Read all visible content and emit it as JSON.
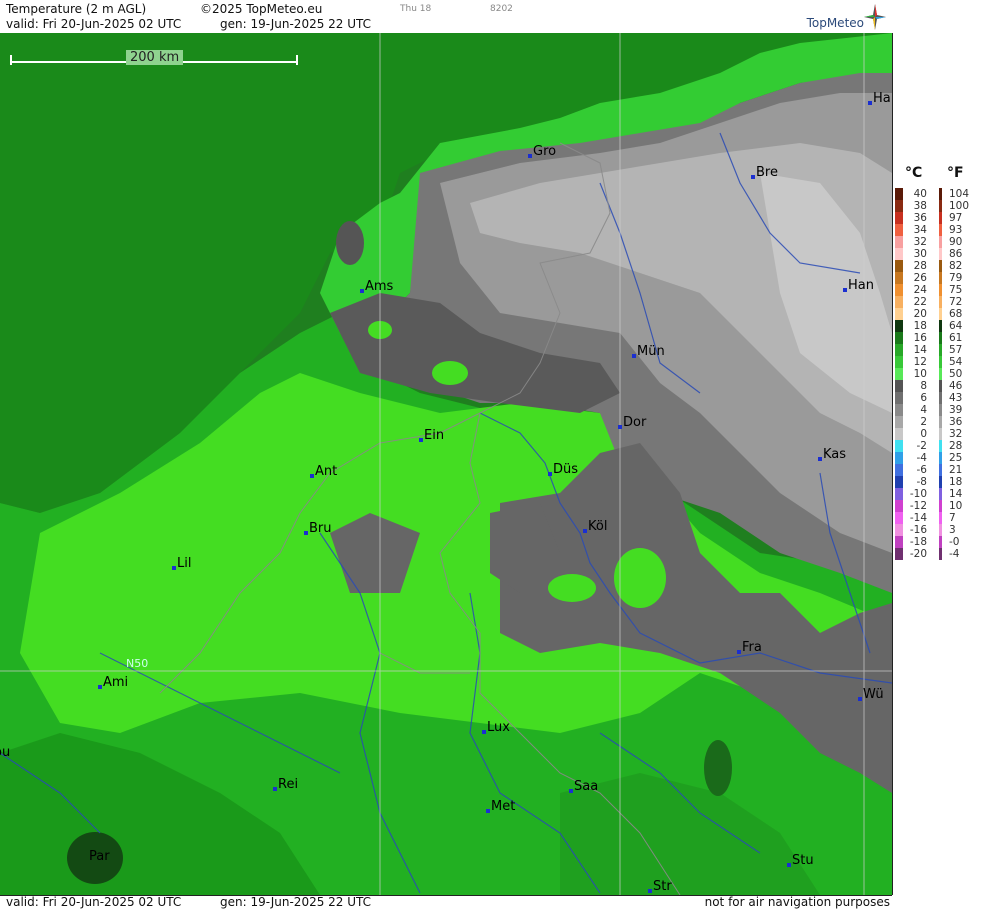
{
  "header": {
    "title": "Temperature (2 m AGL)",
    "copyright": "©2025 TopMeteo.eu",
    "valid": "valid:  Fri  20-Jun-2025  02 UTC",
    "gen": "gen: 19-Jun-2025 22 UTC",
    "small_day": "Thu 18",
    "small_code": "8202",
    "brand": "TopMeteo"
  },
  "footer": {
    "valid": "valid:  Fri  20-Jun-2025  02 UTC",
    "gen": "gen: 19-Jun-2025 22 UTC",
    "disclaimer": "not for air navigation purposes"
  },
  "map": {
    "scale_label": "200 km",
    "gridline_label": "N50",
    "cities": [
      {
        "name": "Gro"
      },
      {
        "name": "Bre"
      },
      {
        "name": "Ha"
      },
      {
        "name": "Ams"
      },
      {
        "name": "Han"
      },
      {
        "name": "Mün"
      },
      {
        "name": "Ein"
      },
      {
        "name": "Dor"
      },
      {
        "name": "Ant"
      },
      {
        "name": "Düs"
      },
      {
        "name": "Kas"
      },
      {
        "name": "Bru"
      },
      {
        "name": "Köl"
      },
      {
        "name": "Lil"
      },
      {
        "name": "Fra"
      },
      {
        "name": "Ami"
      },
      {
        "name": "Wü"
      },
      {
        "name": "ou"
      },
      {
        "name": "Lux"
      },
      {
        "name": "Rei"
      },
      {
        "name": "Saa"
      },
      {
        "name": "Met"
      },
      {
        "name": "Par"
      },
      {
        "name": "Stu"
      },
      {
        "name": "Str"
      }
    ]
  },
  "legend": {
    "celsius_label": "°C",
    "fahrenheit_label": "°F",
    "celsius": [
      "40",
      "38",
      "36",
      "34",
      "32",
      "30",
      "28",
      "26",
      "24",
      "22",
      "20",
      "18",
      "16",
      "14",
      "12",
      "10",
      "8",
      "6",
      "4",
      "2",
      "0",
      "-2",
      "-4",
      "-6",
      "-8",
      "-10",
      "-12",
      "-14",
      "-16",
      "-18",
      "-20"
    ],
    "fahrenheit": [
      "104",
      "100",
      "97",
      "93",
      "90",
      "86",
      "82",
      "79",
      "75",
      "72",
      "68",
      "64",
      "61",
      "57",
      "54",
      "50",
      "46",
      "43",
      "39",
      "36",
      "32",
      "28",
      "25",
      "21",
      "18",
      "14",
      "10",
      "7",
      "3",
      "-0",
      "-4"
    ],
    "colors": [
      "#5a1a08",
      "#8a2a12",
      "#c83020",
      "#f06040",
      "#f8a0a0",
      "#ffc8c8",
      "#9a5a10",
      "#c87820",
      "#f09030",
      "#f8b060",
      "#ffd090",
      "#103810",
      "#1a7a1a",
      "#28a828",
      "#38c838",
      "#58e858",
      "#555555",
      "#707070",
      "#8a8a8a",
      "#a8a8a8",
      "#c8c8c8",
      "#40e0f0",
      "#30a0e8",
      "#4070e0",
      "#2040b0",
      "#8060e0",
      "#d040d0",
      "#f060f0",
      "#f090e0",
      "#c040c0",
      "#703070"
    ]
  }
}
